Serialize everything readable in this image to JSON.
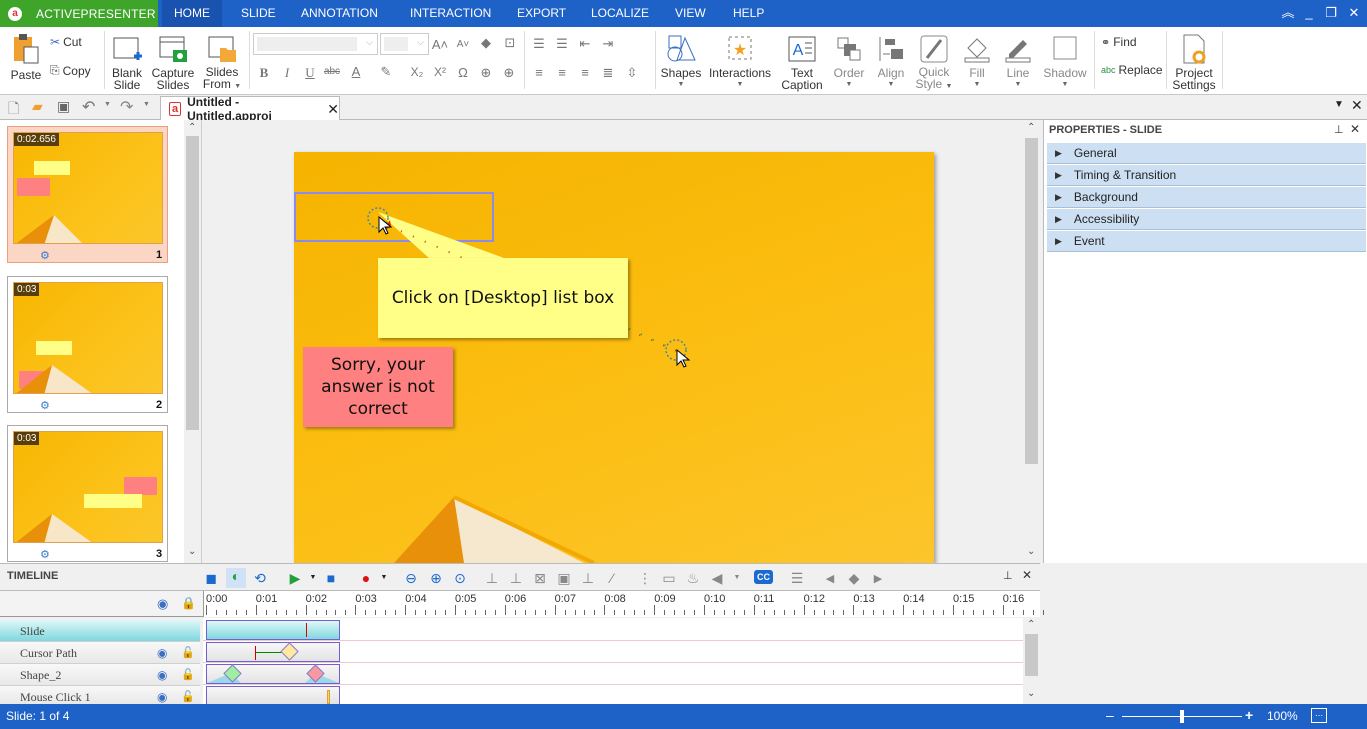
{
  "app": {
    "name": "ACTIVEPRESENTER",
    "logo": "activepresenter-logo"
  },
  "menu": {
    "tabs": [
      "HOME",
      "SLIDE",
      "ANNOTATION",
      "INTERACTION",
      "EXPORT",
      "LOCALIZE",
      "VIEW",
      "HELP"
    ],
    "active": "HOME"
  },
  "window_controls": {
    "collapse": "⌃",
    "minimize": "_",
    "restore": "❐",
    "close": "✕"
  },
  "ribbon": {
    "paste": "Paste",
    "cut": "Cut",
    "copy": "Copy",
    "blank_slide": [
      "Blank",
      "Slide"
    ],
    "capture_slides": [
      "Capture",
      "Slides"
    ],
    "slides_from": [
      "Slides",
      "From"
    ],
    "font_name": "",
    "font_size": "",
    "shapes": "Shapes",
    "interactions": "Interactions",
    "text_caption": [
      "Text",
      "Caption"
    ],
    "order": "Order",
    "align": "Align",
    "quick_style": [
      "Quick",
      "Style"
    ],
    "fill": "Fill",
    "line": "Line",
    "shadow": "Shadow",
    "find": "Find",
    "replace": "Replace",
    "project_settings": [
      "Project",
      "Settings"
    ]
  },
  "document": {
    "tab_title": "Untitled - Untitled.approj"
  },
  "slides": [
    {
      "number": "1",
      "duration": "0:02.656",
      "selected": true
    },
    {
      "number": "2",
      "duration": "0:03",
      "selected": false
    },
    {
      "number": "3",
      "duration": "0:03",
      "selected": false
    }
  ],
  "canvas": {
    "caption_text": "Click on [Desktop] list box",
    "failure_text": "Sorry, your answer is not correct",
    "colors": {
      "background": "#fbbd10",
      "caption": "#ffff88",
      "failure": "#ff8080",
      "click_area_border": "#8080ff"
    }
  },
  "properties": {
    "title": "PROPERTIES - SLIDE",
    "sections": [
      "General",
      "Timing & Transition",
      "Background",
      "Accessibility",
      "Event"
    ]
  },
  "timeline": {
    "title": "TIMELINE",
    "ticks": [
      "0:00",
      "0:01",
      "0:02",
      "0:03",
      "0:04",
      "0:05",
      "0:06",
      "0:07",
      "0:08",
      "0:09",
      "0:10",
      "0:11",
      "0:12",
      "0:13",
      "0:14",
      "0:15",
      "0:16"
    ],
    "tracks": [
      {
        "name": "Slide"
      },
      {
        "name": "Cursor Path"
      },
      {
        "name": "Shape_2"
      },
      {
        "name": "Mouse Click  1"
      }
    ],
    "cc_label": "CC"
  },
  "status": {
    "slide_info": "Slide: 1 of 4",
    "zoom": "100%",
    "zoom_fraction": 0.5
  }
}
